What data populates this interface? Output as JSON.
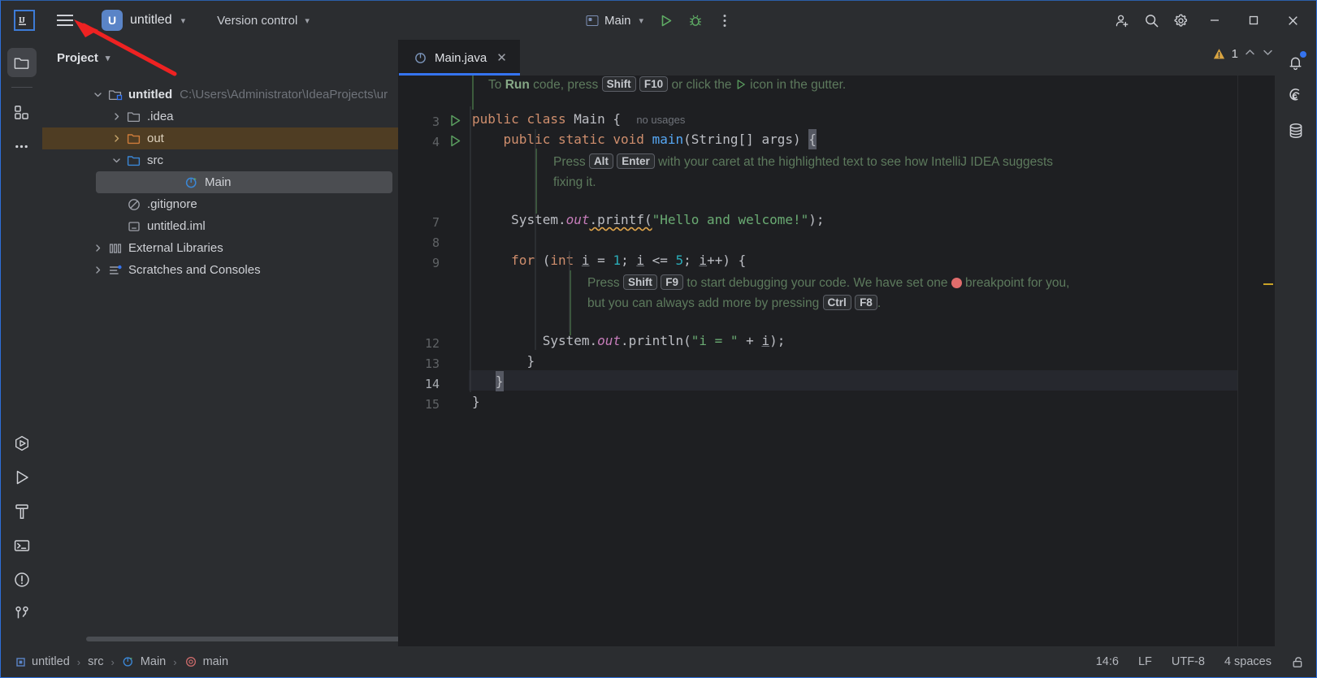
{
  "window": {
    "app_logo": "intellij-idea-logo",
    "project_badge": "U",
    "project_name": "untitled",
    "version_control_label": "Version control",
    "run_config_label": "Main",
    "buttons": {
      "minimize": "–",
      "maximize": "□",
      "close": "✕"
    }
  },
  "toolbar_icons": {
    "menu": "hamburger-icon",
    "run": "run-icon",
    "debug": "debug-icon",
    "more": "more-vertical-icon",
    "add_user": "add-user-icon",
    "search": "search-icon",
    "settings": "gear-icon"
  },
  "left_rail": {
    "top": [
      {
        "name": "project-tool-window",
        "icon": "folder-icon",
        "active": true
      },
      {
        "name": "structure-tool-window",
        "icon": "structure-icon",
        "active": false
      },
      {
        "name": "more-tool-windows",
        "icon": "more-horizontal-icon",
        "active": false
      }
    ],
    "bottom": [
      {
        "name": "run-with-coverage",
        "icon": "coverage-icon"
      },
      {
        "name": "run-tool-window",
        "icon": "play-icon"
      },
      {
        "name": "build-tool-window",
        "icon": "hammer-icon"
      },
      {
        "name": "terminal-tool-window",
        "icon": "terminal-icon"
      },
      {
        "name": "problems-tool-window",
        "icon": "warning-circle-icon"
      },
      {
        "name": "version-control-tool-window",
        "icon": "branch-icon"
      }
    ]
  },
  "right_rail": [
    {
      "name": "notifications",
      "icon": "bell-icon",
      "badge": true
    },
    {
      "name": "ai-assistant",
      "icon": "spiral-icon",
      "badge": false
    },
    {
      "name": "database",
      "icon": "database-icon",
      "badge": false
    }
  ],
  "project_panel": {
    "title": "Project",
    "tree": [
      {
        "label": "untitled",
        "path": "C:\\Users\\Administrator\\IdeaProjects\\ur",
        "icon": "module-folder-icon",
        "arrow": "down",
        "indent": 0,
        "bold": true,
        "state": "normal"
      },
      {
        "label": ".idea",
        "path": "",
        "icon": "folder-icon",
        "arrow": "right",
        "indent": 1,
        "bold": false,
        "state": "normal"
      },
      {
        "label": "out",
        "path": "",
        "icon": "folder-orange-icon",
        "arrow": "right",
        "indent": 1,
        "bold": false,
        "state": "excluded"
      },
      {
        "label": "src",
        "path": "",
        "icon": "folder-blue-icon",
        "arrow": "down",
        "indent": 1,
        "bold": false,
        "state": "normal"
      },
      {
        "label": "Main",
        "path": "",
        "icon": "java-class-icon",
        "arrow": "none",
        "indent": 2,
        "bold": false,
        "state": "selected"
      },
      {
        "label": ".gitignore",
        "path": "",
        "icon": "gitignore-icon",
        "arrow": "none",
        "indent": 1,
        "bold": false,
        "state": "normal"
      },
      {
        "label": "untitled.iml",
        "path": "",
        "icon": "iml-icon",
        "arrow": "none",
        "indent": 1,
        "bold": false,
        "state": "normal"
      },
      {
        "label": "External Libraries",
        "path": "",
        "icon": "libraries-icon",
        "arrow": "right",
        "indent": 0,
        "bold": false,
        "state": "normal"
      },
      {
        "label": "Scratches and Consoles",
        "path": "",
        "icon": "scratches-icon",
        "arrow": "right",
        "indent": 0,
        "bold": false,
        "state": "normal"
      }
    ]
  },
  "editor": {
    "tab": {
      "label": "Main.java",
      "icon": "java-class-icon",
      "close": "✕"
    },
    "warning_count": "1",
    "banner": {
      "prefix": "To ",
      "run_word": "Run",
      "mid": " code, press ",
      "key1": "Shift",
      "key2": "F10",
      "mid2": " or click the ",
      "suffix": " icon in the gutter."
    },
    "lines": [
      {
        "number": "3",
        "runmarker": true
      },
      {
        "number": "4",
        "runmarker": true
      },
      {
        "number": "7",
        "runmarker": false
      },
      {
        "number": "8",
        "runmarker": false
      },
      {
        "number": "9",
        "runmarker": false
      },
      {
        "number": "12",
        "runmarker": false
      },
      {
        "number": "13",
        "runmarker": false
      },
      {
        "number": "14",
        "runmarker": false,
        "current": true
      },
      {
        "number": "15",
        "runmarker": false
      }
    ],
    "code": {
      "line3_kw1": "public",
      "line3_kw2": "class",
      "line3_cls": "Main",
      "line3_brace": "{",
      "line3_usages": "no usages",
      "line4": "public static void main(String[] args) {",
      "line7_obj": "System.",
      "line7_field": "out",
      "line7_call": ".printf(",
      "line7_str": "\"Hello and welcome!\"",
      "line7_end": ");",
      "line9": "for (int i = 1; i <= 5; i++) {",
      "line12_obj": "System.",
      "line12_field": "out",
      "line12_call": ".println(",
      "line12_str": "\"i = \"",
      "line12_concat": " + i);",
      "line13": "}",
      "line14": "}",
      "line15": "}"
    },
    "hint1": {
      "press": "Press ",
      "key1": "Alt",
      "key2": "Enter",
      "text": " with your caret at the highlighted text to see how IntelliJ IDEA suggests",
      "line2": "fixing it."
    },
    "hint2": {
      "press": "Press ",
      "key1": "Shift",
      "key2": "F9",
      "text": " to start debugging your code. We have set one ",
      "text2": " breakpoint for you,",
      "line2a": "but you can always add more by pressing ",
      "key3": "Ctrl",
      "key4": "F8",
      "line2b": "."
    }
  },
  "status_bar": {
    "breadcrumbs": [
      {
        "label": "untitled",
        "icon": "module-icon"
      },
      {
        "label": "src",
        "icon": "none"
      },
      {
        "label": "Main",
        "icon": "java-class-icon"
      },
      {
        "label": "main",
        "icon": "method-icon"
      }
    ],
    "separator": "›",
    "position": "14:6",
    "line_separator": "LF",
    "encoding": "UTF-8",
    "indent": "4 spaces",
    "lock_icon": "unlocked-icon"
  },
  "colors": {
    "accent": "#3574f0",
    "titlebar_bg": "#2b2d30",
    "editor_bg": "#1e1f22",
    "keyword": "#cf8e6d",
    "string": "#6aab73",
    "number": "#2aacb8",
    "method": "#56a8f5",
    "hint_green": "#5d7a5d",
    "warning": "#e0a54b",
    "breakpoint": "#e06c6c",
    "excluded_row": "#4f3d23",
    "annotation_arrow": "#ee2222"
  }
}
